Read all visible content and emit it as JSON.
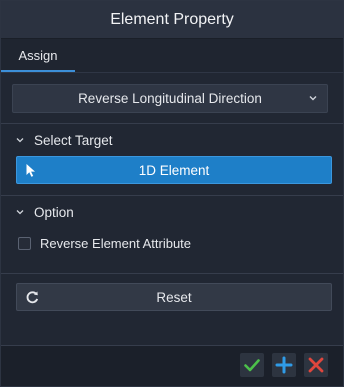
{
  "window": {
    "title": "Element Property"
  },
  "tabs": [
    {
      "label": "Assign"
    }
  ],
  "operation": {
    "selected": "Reverse Longitudinal Direction"
  },
  "select_target": {
    "header": "Select Target",
    "button_label": "1D Element"
  },
  "option": {
    "header": "Option",
    "reverse_attribute_label": "Reverse Element Attribute",
    "reverse_attribute_checked": false
  },
  "reset": {
    "label": "Reset"
  },
  "colors": {
    "accent": "#1e7fc8",
    "ok": "#4cc04a",
    "add": "#2f9be8",
    "cancel": "#e0463d"
  },
  "footer_icons": [
    "check-icon",
    "plus-icon",
    "close-icon"
  ]
}
